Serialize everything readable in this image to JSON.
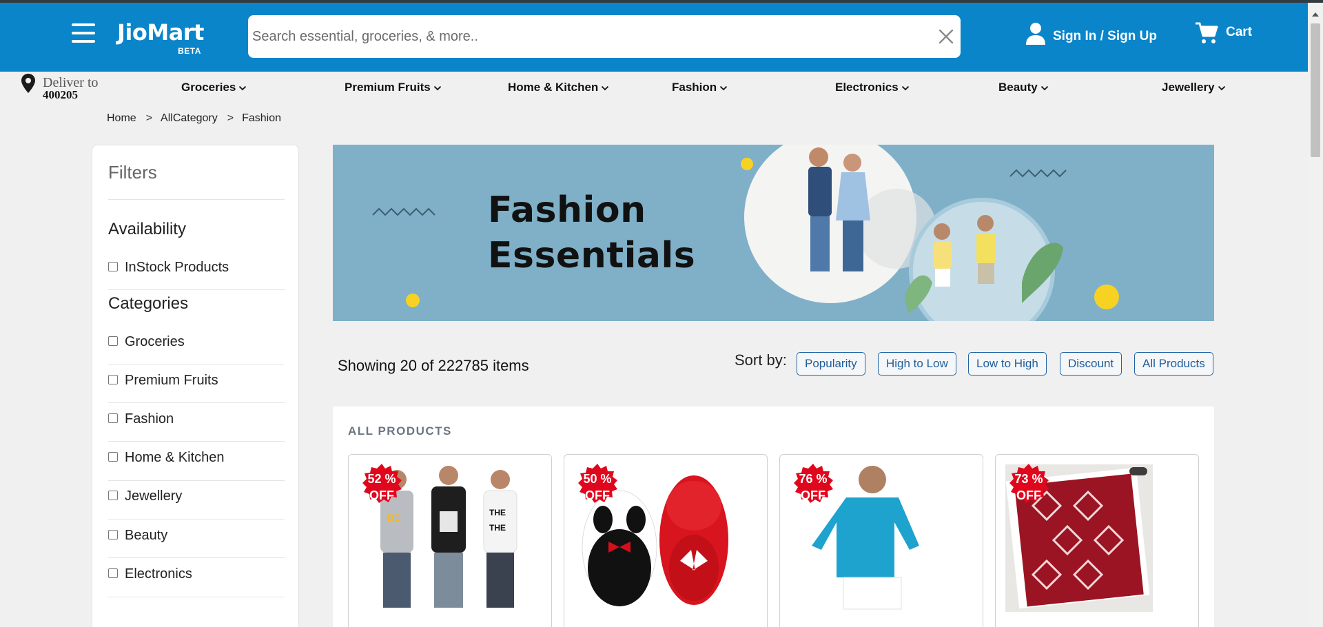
{
  "header": {
    "logo_text": "JioMart",
    "logo_badge": "BETA",
    "search_placeholder": "Search essential, groceries, & more..",
    "search_value": "",
    "signin_label": "Sign In / Sign Up",
    "cart_label": "Cart",
    "brand_color": "#0a85c9"
  },
  "deliver": {
    "label": "Deliver to",
    "pincode": "400205"
  },
  "nav": {
    "items": [
      {
        "label": "Groceries"
      },
      {
        "label": "Premium Fruits"
      },
      {
        "label": "Home & Kitchen"
      },
      {
        "label": "Fashion"
      },
      {
        "label": "Electronics"
      },
      {
        "label": "Beauty"
      },
      {
        "label": "Jewellery"
      }
    ]
  },
  "breadcrumb": {
    "items": [
      "Home",
      "AllCategory",
      "Fashion"
    ],
    "separator": ">"
  },
  "filters": {
    "title": "Filters",
    "availability": {
      "title": "Availability",
      "options": [
        "InStock Products"
      ]
    },
    "categories": {
      "title": "Categories",
      "options": [
        "Groceries",
        "Premium Fruits",
        "Fashion",
        "Home & Kitchen",
        "Jewellery",
        "Beauty",
        "Electronics"
      ]
    }
  },
  "banner": {
    "line1": "Fashion",
    "line2": "Essentials"
  },
  "listing": {
    "showing_text": "Showing 20 of 222785 items",
    "sort_label": "Sort by:",
    "sort_options": [
      "Popularity",
      "High to Low",
      "Low to High",
      "Discount",
      "All Products"
    ]
  },
  "products": {
    "title": "ALL PRODUCTS",
    "items": [
      {
        "discount": "52 %",
        "off": "OFF",
        "image": "three-men-tshirts"
      },
      {
        "discount": "50 %",
        "off": "OFF",
        "image": "panda-spiderman-bags"
      },
      {
        "discount": "76 %",
        "off": "OFF",
        "image": "boy-blue-kurta"
      },
      {
        "discount": "73 %",
        "off": "OFF",
        "image": "red-printed-fabric"
      }
    ]
  }
}
